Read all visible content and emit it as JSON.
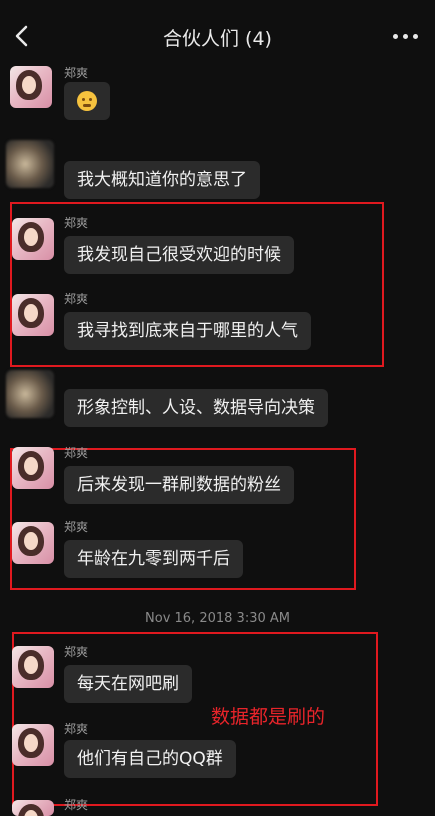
{
  "header": {
    "title": "合伙人们 (4)"
  },
  "messages": [
    {
      "sender": "郑爽",
      "text": ""
    },
    {
      "sender": "",
      "text": "我大概知道你的意思了"
    },
    {
      "sender": "郑爽",
      "text": "我发现自己很受欢迎的时候"
    },
    {
      "sender": "郑爽",
      "text": "我寻找到底来自于哪里的人气"
    },
    {
      "sender": "",
      "text": "形象控制、人设、数据导向决策"
    },
    {
      "sender": "郑爽",
      "text": "后来发现一群刷数据的粉丝"
    },
    {
      "sender": "郑爽",
      "text": "年龄在九零到两千后"
    },
    {
      "sender": "郑爽",
      "text": "每天在网吧刷"
    },
    {
      "sender": "郑爽",
      "text": "他们有自己的QQ群"
    },
    {
      "sender": "郑爽",
      "text": ""
    }
  ],
  "timestamp": "Nov 16, 2018 3:30 AM",
  "annotation": "数据都是刷的",
  "colors": {
    "background": "#0f0f0f",
    "bubble": "#2b2b2b",
    "highlight": "#e0191f"
  },
  "icons": {
    "back": "chevron-left-icon",
    "more": "more-dots-icon",
    "emoji": "thinking-face-icon"
  }
}
